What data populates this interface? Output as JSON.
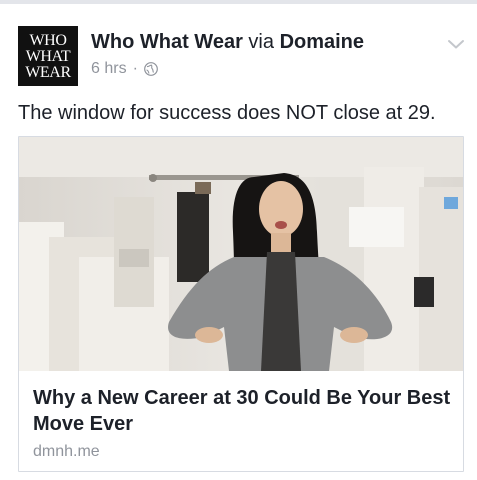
{
  "post": {
    "avatar_lines": [
      "WHO",
      "WHAT",
      "WEAR"
    ],
    "author": "Who What Wear",
    "via_text": "via",
    "source": "Domaine",
    "time": "6 hrs",
    "separator": "·",
    "privacy_icon": "globe-icon",
    "menu_icon": "chevron-down-icon",
    "message": "The window for success does NOT close at 29."
  },
  "link_card": {
    "image_icon": "photo",
    "title": "Why a New Career at 30 Could Be Your Best Move Ever",
    "domain": "dmnh.me"
  },
  "colors": {
    "text": "#1d2129",
    "meta": "#90949c",
    "border": "#d7dbe2"
  }
}
